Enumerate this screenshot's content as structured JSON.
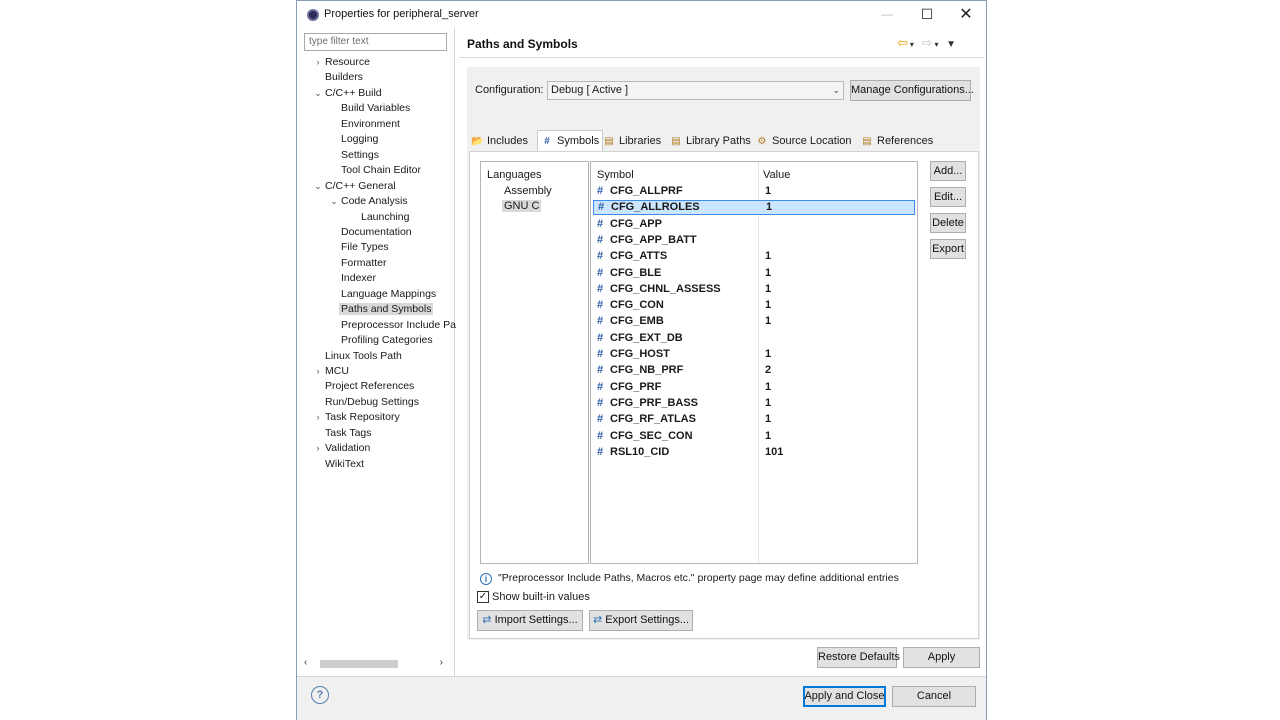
{
  "window": {
    "title": "Properties for peripheral_server"
  },
  "filter": {
    "placeholder": "type filter text"
  },
  "tree": [
    {
      "label": "Resource",
      "level": 0,
      "expander": "›"
    },
    {
      "label": "Builders",
      "level": 0,
      "expander": ""
    },
    {
      "label": "C/C++ Build",
      "level": 0,
      "expander": "⌄"
    },
    {
      "label": "Build Variables",
      "level": 1,
      "expander": ""
    },
    {
      "label": "Environment",
      "level": 1,
      "expander": ""
    },
    {
      "label": "Logging",
      "level": 1,
      "expander": ""
    },
    {
      "label": "Settings",
      "level": 1,
      "expander": ""
    },
    {
      "label": "Tool Chain Editor",
      "level": 1,
      "expander": ""
    },
    {
      "label": "C/C++ General",
      "level": 0,
      "expander": "⌄"
    },
    {
      "label": "Code Analysis",
      "level": 1,
      "expander": "⌄"
    },
    {
      "label": "Launching",
      "level": 2,
      "expander": ""
    },
    {
      "label": "Documentation",
      "level": 1,
      "expander": ""
    },
    {
      "label": "File Types",
      "level": 1,
      "expander": ""
    },
    {
      "label": "Formatter",
      "level": 1,
      "expander": ""
    },
    {
      "label": "Indexer",
      "level": 1,
      "expander": ""
    },
    {
      "label": "Language Mappings",
      "level": 1,
      "expander": ""
    },
    {
      "label": "Paths and Symbols",
      "level": 1,
      "expander": "",
      "selected": true
    },
    {
      "label": "Preprocessor Include Pa",
      "level": 1,
      "expander": ""
    },
    {
      "label": "Profiling Categories",
      "level": 1,
      "expander": ""
    },
    {
      "label": "Linux Tools Path",
      "level": 0,
      "expander": ""
    },
    {
      "label": "MCU",
      "level": 0,
      "expander": "›"
    },
    {
      "label": "Project References",
      "level": 0,
      "expander": ""
    },
    {
      "label": "Run/Debug Settings",
      "level": 0,
      "expander": ""
    },
    {
      "label": "Task Repository",
      "level": 0,
      "expander": "›"
    },
    {
      "label": "Task Tags",
      "level": 0,
      "expander": ""
    },
    {
      "label": "Validation",
      "level": 0,
      "expander": "›"
    },
    {
      "label": "WikiText",
      "level": 0,
      "expander": ""
    }
  ],
  "page": {
    "title": "Paths and Symbols"
  },
  "config": {
    "label": "Configuration:",
    "value": "Debug  [ Active ]",
    "manage_label": "Manage Configurations..."
  },
  "tabs": [
    {
      "label": "Includes",
      "icon": "includes-icon",
      "glyph": "📂"
    },
    {
      "label": "Symbols",
      "icon": "hash-icon",
      "glyph": "#"
    },
    {
      "label": "Libraries",
      "icon": "library-icon",
      "glyph": "▤"
    },
    {
      "label": "Library Paths",
      "icon": "library-path-icon",
      "glyph": "▤"
    },
    {
      "label": "Source Location",
      "icon": "source-icon",
      "glyph": "⚙"
    },
    {
      "label": "References",
      "icon": "references-icon",
      "glyph": "▤"
    }
  ],
  "languages": {
    "header": "Languages",
    "items": [
      "Assembly",
      "GNU C"
    ],
    "selected_index": 1
  },
  "symbols": {
    "headers": [
      "Symbol",
      "Value"
    ],
    "rows": [
      {
        "name": "CFG_ALLPRF",
        "value": "1"
      },
      {
        "name": "CFG_ALLROLES",
        "value": "1",
        "selected": true
      },
      {
        "name": "CFG_APP",
        "value": ""
      },
      {
        "name": "CFG_APP_BATT",
        "value": ""
      },
      {
        "name": "CFG_ATTS",
        "value": "1"
      },
      {
        "name": "CFG_BLE",
        "value": "1"
      },
      {
        "name": "CFG_CHNL_ASSESS",
        "value": "1"
      },
      {
        "name": "CFG_CON",
        "value": "1"
      },
      {
        "name": "CFG_EMB",
        "value": "1"
      },
      {
        "name": "CFG_EXT_DB",
        "value": ""
      },
      {
        "name": "CFG_HOST",
        "value": "1"
      },
      {
        "name": "CFG_NB_PRF",
        "value": "2"
      },
      {
        "name": "CFG_PRF",
        "value": "1"
      },
      {
        "name": "CFG_PRF_BASS",
        "value": "1"
      },
      {
        "name": "CFG_RF_ATLAS",
        "value": "1"
      },
      {
        "name": "CFG_SEC_CON",
        "value": "1"
      },
      {
        "name": "RSL10_CID",
        "value": "101"
      }
    ]
  },
  "side_buttons": {
    "add": "Add...",
    "edit": "Edit...",
    "delete": "Delete",
    "export": "Export"
  },
  "info": {
    "text": "\"Preprocessor Include Paths, Macros etc.\" property page may define additional entries"
  },
  "show_builtin": {
    "label": "Show built-in values",
    "checked": true
  },
  "settings_buttons": {
    "import": "Import Settings...",
    "export": "Export Settings..."
  },
  "page_buttons": {
    "restore": "Restore Defaults",
    "apply": "Apply"
  },
  "footer": {
    "apply_close": "Apply and Close",
    "cancel": "Cancel"
  }
}
